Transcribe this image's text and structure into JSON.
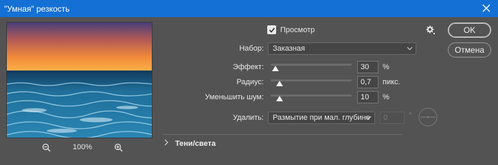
{
  "window": {
    "title": "\"Умная\" резкость"
  },
  "preview": {
    "zoom_label": "100%",
    "checkbox_label": "Просмотр",
    "checked": true
  },
  "settings": {
    "preset_label": "Набор:",
    "preset_value": "Заказная",
    "amount": {
      "label": "Эффект:",
      "value": "30",
      "unit": "%",
      "level": 0.05
    },
    "radius": {
      "label": "Радиус:",
      "value": "0,7",
      "unit": "пикс.",
      "level": 0.1
    },
    "noise": {
      "label": "Уменьшить шум:",
      "value": "10",
      "unit": "%",
      "level": 0.1
    },
    "remove_label": "Удалить:",
    "remove_value": "Размытие при мал. глубине",
    "angle_value": "0",
    "angle_unit": "°"
  },
  "buttons": {
    "ok": "OK",
    "cancel": "Отмена"
  },
  "section": {
    "shadows_highlights": "Тени/света"
  },
  "icons": {
    "close": "close-icon",
    "zoom_out": "zoom-out-icon",
    "zoom_in": "zoom-in-icon",
    "gear": "gear-icon",
    "chevron": "chevron-down-icon",
    "expand": "chevron-right-icon"
  },
  "colors": {
    "titlebar": "#1470d4",
    "panel": "#535353"
  }
}
